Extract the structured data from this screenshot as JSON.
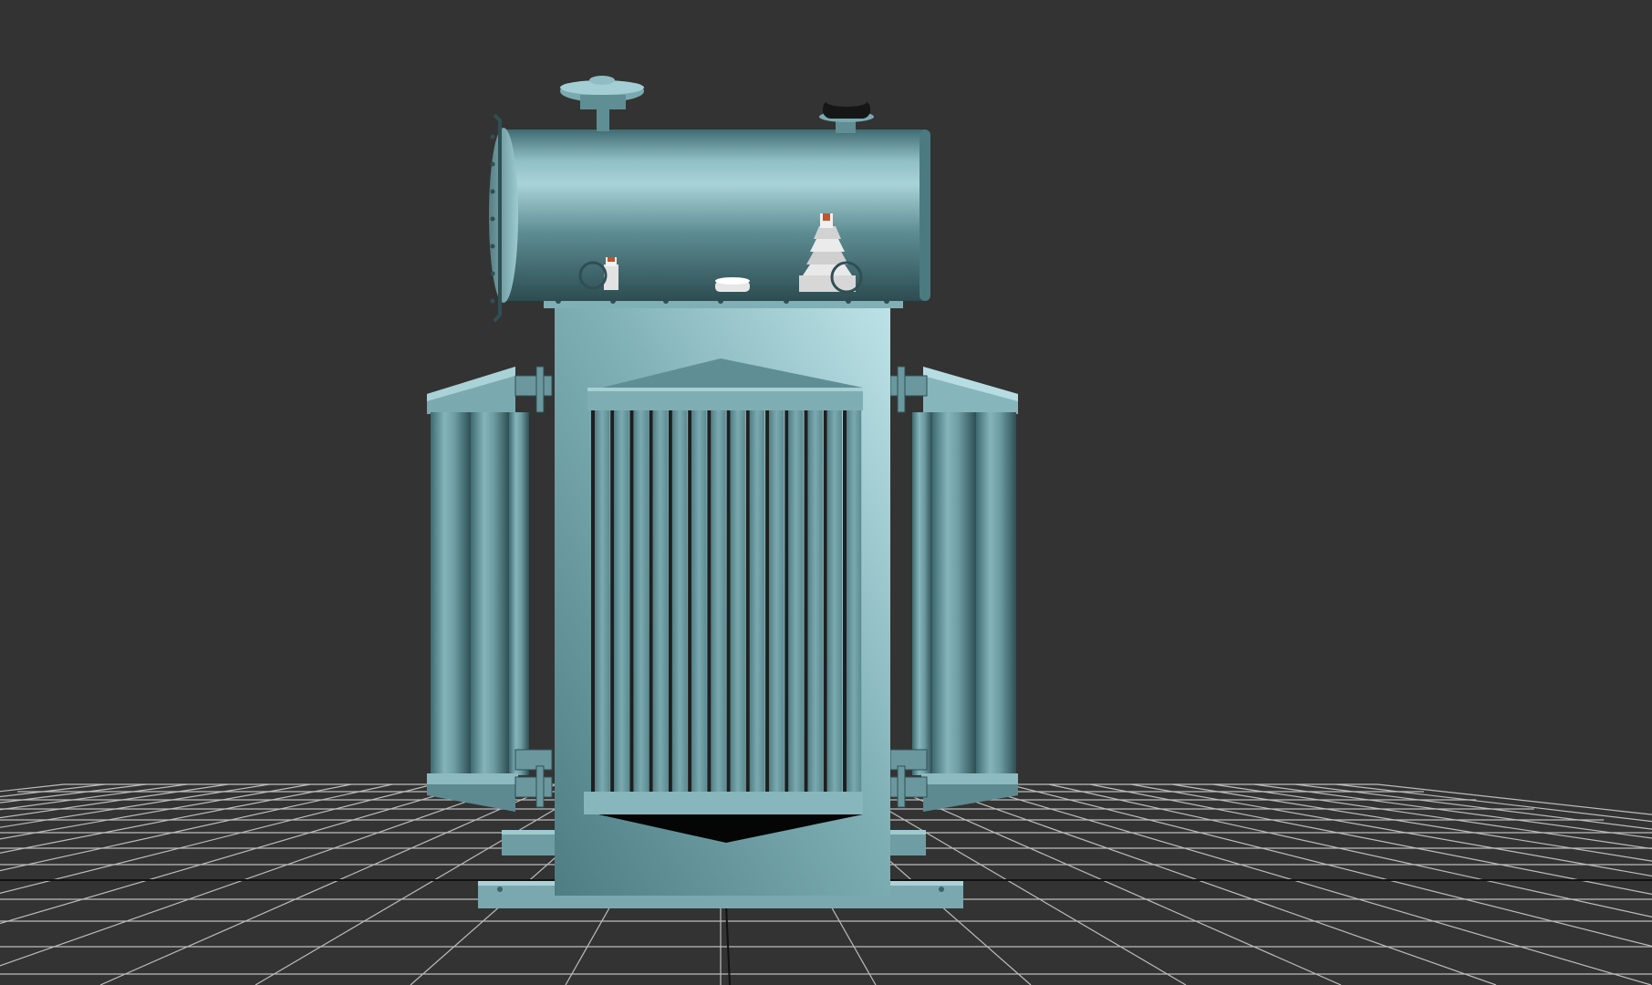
{
  "scene": {
    "viewport_background": "#333333",
    "ground_grid": {
      "visible": true,
      "line_color": "#bdbdbd",
      "major_axis_color": "#000000"
    },
    "object": {
      "kind": "oil-immersed power transformer",
      "body_color": "#6f9ea4",
      "highlight_color": "#b8dfe4",
      "shadow_color": "#2f4d52",
      "radiator_fins_front": 14,
      "side_radiator_tubes_per_bank": 3
    }
  }
}
